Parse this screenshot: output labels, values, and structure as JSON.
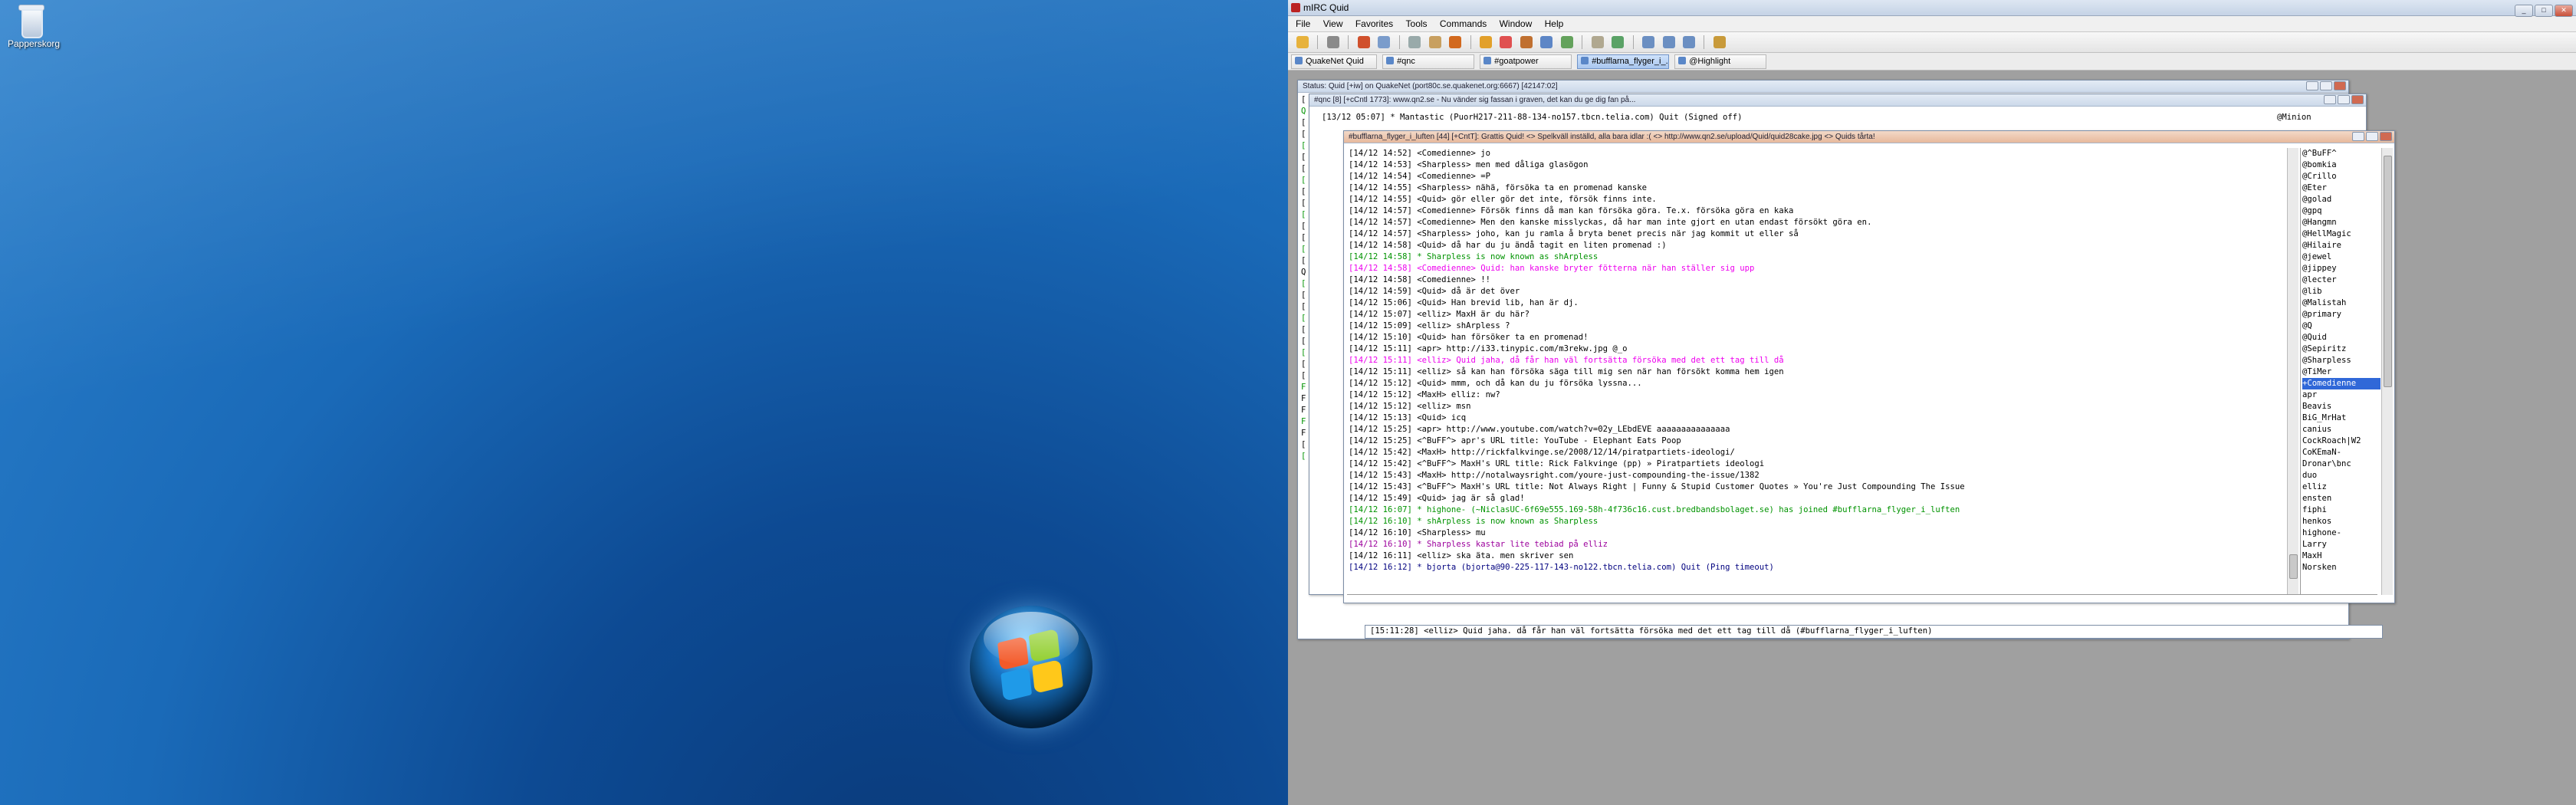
{
  "desktop": {
    "recycle_bin_label": "Papperskorg"
  },
  "mirc": {
    "title": "mIRC Quid",
    "menu": [
      "File",
      "View",
      "Favorites",
      "Tools",
      "Commands",
      "Window",
      "Help"
    ],
    "switchbar": [
      {
        "label": "QuakeNet Quid",
        "active": false
      },
      {
        "label": "#qnc",
        "active": false
      },
      {
        "label": "#goatpower",
        "active": false
      },
      {
        "label": "#bufflarna_flyger_i_...",
        "active": true
      },
      {
        "label": "@Highlight",
        "active": false
      }
    ]
  },
  "status_window": {
    "title": "Status: Quid [+iw] on QuakeNet (port80c.se.quakenet.org:6667) [42147:02]",
    "left_fragments": [
      "[",
      "Q",
      "[",
      "[",
      "[",
      "[",
      "[",
      "[",
      "[",
      "[",
      "[",
      "[",
      "[",
      "[",
      "[",
      "Q",
      "[",
      "[",
      "[",
      "[",
      "[",
      "[",
      "[",
      "[",
      "[",
      "F",
      "F",
      "F",
      "F",
      "F",
      "[",
      "["
    ],
    "bottom_line": "[15:11:28] <elliz> Quid jaha. då får han väl fortsätta försöka med det ett tag till då (#bufflarna_flyger_i_luften)"
  },
  "qnc_window": {
    "title": "#qnc [8] [+cCntl 1773]: www.qn2.se - Nu vänder sig fassan i graven, det kan du ge dig fan på...",
    "line": "[13/12 05:07] * Mantastic (PuorH217-211-88-134-no157.tbcn.telia.com) Quit (Signed off)",
    "nick": "@Minion"
  },
  "bufflarna_window": {
    "title": "#bufflarna_flyger_i_luften [44] [+CntT]: Grattis Quid! <> Spelkväll inställd, alla bara idlar :( <> http://www.qn2.se/upload/Quid/quid28cake.jpg <> Quids tårta!",
    "lines": [
      {
        "text": "[14/12 14:52] <Comedienne> jo",
        "color": "black"
      },
      {
        "text": "[14/12 14:53] <Sharpless> men med dåliga glasögon",
        "color": "black"
      },
      {
        "text": "[14/12 14:54] <Comedienne> =P",
        "color": "black"
      },
      {
        "text": "[14/12 14:55] <Sharpless> nähä, försöka ta en promenad kanske",
        "color": "black"
      },
      {
        "text": "[14/12 14:55] <Quid> gör eller gör det inte, försök finns inte.",
        "color": "black"
      },
      {
        "text": "[14/12 14:57] <Comedienne> Försök finns då man kan försöka göra. Te.x. försöka göra en kaka",
        "color": "black"
      },
      {
        "text": "[14/12 14:57] <Comedienne> Men den kanske misslyckas, då har man inte gjort en utan endast försökt göra en.",
        "color": "black"
      },
      {
        "text": "[14/12 14:57] <Sharpless> joho, kan ju ramla å bryta benet precis när jag kommit ut eller så",
        "color": "black"
      },
      {
        "text": "[14/12 14:58] <Quid> då har du ju ändå tagit en liten promenad :)",
        "color": "black"
      },
      {
        "text": "[14/12 14:58] * Sharpless is now known as shArpless",
        "color": "green"
      },
      {
        "text": "[14/12 14:58] <Comedienne> Quid: han kanske bryter fötterna när han ställer sig upp",
        "color": "magenta"
      },
      {
        "text": "[14/12 14:58] <Comedienne> !!",
        "color": "black"
      },
      {
        "text": "[14/12 14:59] <Quid> då är det över",
        "color": "black"
      },
      {
        "text": "[14/12 15:06] <Quid> Han brevid lib, han är dj.",
        "color": "black"
      },
      {
        "text": "[14/12 15:07] <elliz> MaxH är du här?",
        "color": "black"
      },
      {
        "text": "[14/12 15:09] <elliz> shArpless ?",
        "color": "black"
      },
      {
        "text": "[14/12 15:10] <Quid> han försöker ta en promenad!",
        "color": "black"
      },
      {
        "text": "[14/12 15:11] <apr> http://i33.tinypic.com/m3rekw.jpg @_o",
        "color": "black"
      },
      {
        "text": "[14/12 15:11] <elliz> Quid jaha, då får han väl fortsätta försöka med det ett tag till då",
        "color": "magenta"
      },
      {
        "text": "[14/12 15:11] <elliz> så kan han försöka säga till mig sen när han försökt komma hem igen",
        "color": "black"
      },
      {
        "text": "[14/12 15:12] <Quid> mmm, och då kan du ju försöka lyssna...",
        "color": "black"
      },
      {
        "text": "[14/12 15:12] <MaxH> elliz: nw?",
        "color": "black"
      },
      {
        "text": "[14/12 15:12] <elliz> msn",
        "color": "black"
      },
      {
        "text": "[14/12 15:13] <Quid> icq",
        "color": "black"
      },
      {
        "text": "[14/12 15:25] <apr> http://www.youtube.com/watch?v=02y_LEbdEVE aaaaaaaaaaaaaaa",
        "color": "black"
      },
      {
        "text": "[14/12 15:25] <^BuFF^> apr's URL title: YouTube - Elephant Eats Poop",
        "color": "black"
      },
      {
        "text": "[14/12 15:42] <MaxH> http://rickfalkvinge.se/2008/12/14/piratpartiets-ideologi/",
        "color": "black"
      },
      {
        "text": "[14/12 15:42] <^BuFF^> MaxH's URL title: Rick Falkvinge (pp) » Piratpartiets ideologi",
        "color": "black"
      },
      {
        "text": "[14/12 15:43] <MaxH> http://notalwaysright.com/youre-just-compounding-the-issue/1382",
        "color": "black"
      },
      {
        "text": "[14/12 15:43] <^BuFF^> MaxH's URL title: Not Always Right | Funny & Stupid Customer Quotes » You're Just Compounding The Issue",
        "color": "black"
      },
      {
        "text": "[14/12 15:49] <Quid> jag är så glad!",
        "color": "black"
      },
      {
        "text": "[14/12 16:07] * highone- (~NiclasUC-6f69e555.169-58h-4f736c16.cust.bredbandsbolaget.se) has joined #bufflarna_flyger_i_luften",
        "color": "green"
      },
      {
        "text": "[14/12 16:10] * shArpless is now known as Sharpless",
        "color": "green"
      },
      {
        "text": "[14/12 16:10] <Sharpless> mu",
        "color": "black"
      },
      {
        "text": "[14/12 16:10] * Sharpless kastar lite tebiad på elliz",
        "color": "purple"
      },
      {
        "text": "[14/12 16:11] <elliz> ska äta. men skriver sen",
        "color": "black"
      },
      {
        "text": "[14/12 16:12] * bjorta (bjorta@90-225-117-143-no122.tbcn.telia.com) Quit (Ping timeout)",
        "color": "navy"
      }
    ],
    "nicks": [
      "@^BuFF^",
      "@bomkia",
      "@Crillo",
      "@Eter",
      "@golad",
      "@gpq",
      "@Hangmn",
      "@HellMagic",
      "@Hilaire",
      "@jewel",
      "@jippey",
      "@lecter",
      "@lib",
      "@Malistah",
      "@primary",
      "@Q",
      "@Quid",
      "@Sepiritz",
      "@Sharpless",
      "@TiMer",
      "+Comedienne",
      "apr",
      "Beavis",
      "BiG_MrHat",
      "canius",
      "CockRoach|W2",
      "CoKEmaN-",
      "Dronar\\bnc",
      "duo",
      "elliz",
      "ensten",
      "fiphi",
      "henkos",
      "highone-",
      "Larry",
      "MaxH",
      "Norsken"
    ],
    "selected_nick_index": 20
  }
}
